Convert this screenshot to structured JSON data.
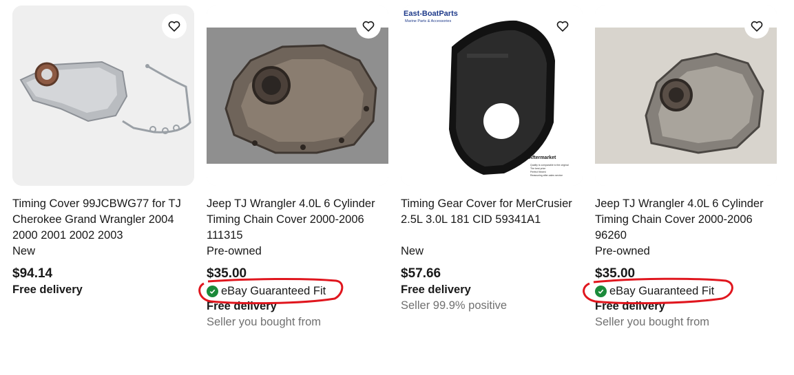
{
  "listings": [
    {
      "title": "Timing Cover 99JCBWG77 for TJ Cherokee Grand Wrangler 2004 2000 2001 2002 2003",
      "condition": "New",
      "price": "$94.14",
      "badge": "",
      "delivery": "Free delivery",
      "seller": "",
      "image_icon": "timing-cover-with-gasket",
      "highlighted": false
    },
    {
      "title": "Jeep TJ Wrangler 4.0L 6 Cylinder Timing Chain Cover 2000-2006 111315",
      "condition": "Pre-owned",
      "price": "$35.00",
      "badge": "eBay Guaranteed Fit",
      "delivery": "Free delivery",
      "seller": "Seller you bought from",
      "image_icon": "rusty-timing-cover",
      "highlighted": true
    },
    {
      "title": "Timing Gear Cover for MerCrusier 2.5L 3.0L 181 CID 59341A1",
      "condition": "New",
      "price": "$57.66",
      "badge": "",
      "delivery": "Free delivery",
      "seller": "Seller 99.9% positive",
      "image_icon": "black-gear-cover",
      "image_brand": "East-BoatParts",
      "image_tagline": "Marine Parts & Accessories",
      "image_note": "Aftermarket",
      "image_bullets": [
        "Quality is comparable to the original",
        "The best price",
        "Perfect fitment",
        "Reassuring after-sales service"
      ],
      "highlighted": false
    },
    {
      "title": "Jeep TJ Wrangler 4.0L 6 Cylinder Timing Chain Cover 2000-2006 96260",
      "condition": "Pre-owned",
      "price": "$35.00",
      "badge": "eBay Guaranteed Fit",
      "delivery": "Free delivery",
      "seller": "Seller you bought from",
      "image_icon": "worn-timing-cover",
      "highlighted": true
    }
  ],
  "icons": {
    "watch": "heart-outline-icon",
    "badge_icon": "check-circle-icon"
  },
  "colors": {
    "price": "#191919",
    "seller": "#707070",
    "check": "#1b8a3a",
    "annotation": "#e0161e"
  }
}
